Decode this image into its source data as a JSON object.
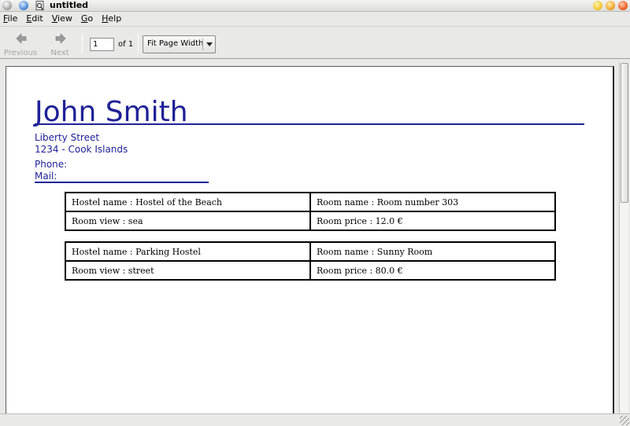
{
  "window": {
    "title": "untitled"
  },
  "menu": {
    "items": [
      {
        "mnemonic": "F",
        "rest": "ile"
      },
      {
        "mnemonic": "E",
        "rest": "dit"
      },
      {
        "mnemonic": "V",
        "rest": "iew"
      },
      {
        "mnemonic": "G",
        "rest": "o"
      },
      {
        "mnemonic": "H",
        "rest": "elp"
      }
    ]
  },
  "toolbar": {
    "previous_label": "Previous",
    "next_label": "Next",
    "page_value": "1",
    "page_of": "of 1",
    "zoom_value": "Fit Page Width"
  },
  "document": {
    "name": "John Smith",
    "street": "Liberty Street",
    "city": "1234  - Cook Islands",
    "phone": "Phone:",
    "mail": "Mail:",
    "bookings": [
      {
        "hostel": "Hostel name : Hostel of the Beach",
        "room": "Room name : Room number 303",
        "view": "Room view : sea",
        "price": "Room price : 12.0 €"
      },
      {
        "hostel": "Hostel name : Parking Hostel",
        "room": "Room name : Sunny Room",
        "view": "Room view : street",
        "price": "Room price : 80.0 €"
      }
    ]
  },
  "colors": {
    "accent": "#1f2197"
  }
}
